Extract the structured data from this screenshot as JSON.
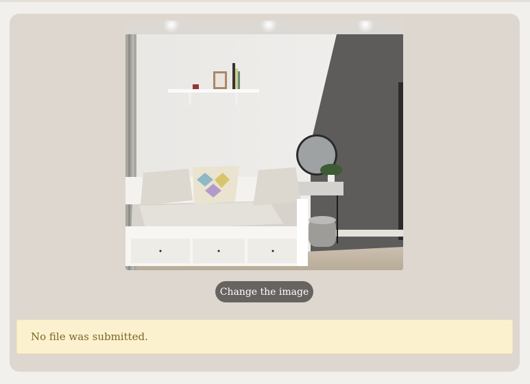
{
  "upload": {
    "image_alt": "Bedroom with daybed, patterned pillows, wall shelf and a round mirror",
    "change_button_label": "Change the image"
  },
  "message": {
    "text": "No file was submitted."
  },
  "colors": {
    "page_bg": "#f2f0ec",
    "card_bg": "#ddd7d0",
    "button_bg": "#676360",
    "notice_bg": "#fcf1cf",
    "notice_text": "#7c6524"
  }
}
